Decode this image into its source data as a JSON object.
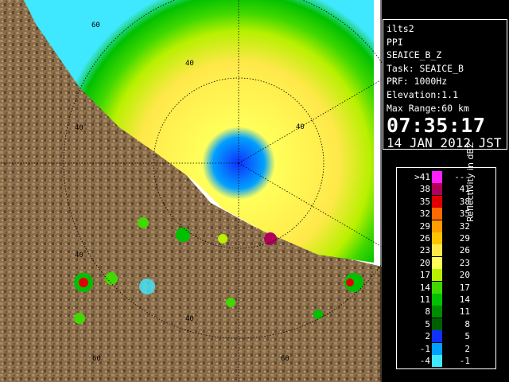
{
  "info": {
    "radar": "ilts2",
    "mode": "PPI",
    "product": "SEAICE_B_Z",
    "task": "Task: SEAICE_B",
    "prf": "PRF: 1000Hz",
    "elevation": "Elevation:1.1",
    "max_range": "Max Range:60 km",
    "time": "07:35:17",
    "date": "14 JAN 2012 JST"
  },
  "map": {
    "range_labels": [
      "60",
      "40",
      "40",
      "40",
      "40",
      "60",
      "40",
      "60"
    ]
  },
  "legend": {
    "title": "Reflectivity in dBZ",
    "rows": [
      {
        "lo": ">41",
        "hi": "---",
        "color": "#ff20ff"
      },
      {
        "lo": "38",
        "hi": "41",
        "color": "#b0005a"
      },
      {
        "lo": "35",
        "hi": "38",
        "color": "#e00000"
      },
      {
        "lo": "32",
        "hi": "35",
        "color": "#ff6a00"
      },
      {
        "lo": "29",
        "hi": "32",
        "color": "#ff9c00"
      },
      {
        "lo": "26",
        "hi": "29",
        "color": "#ffc400"
      },
      {
        "lo": "23",
        "hi": "26",
        "color": "#ffe84a"
      },
      {
        "lo": "20",
        "hi": "23",
        "color": "#ffff5a"
      },
      {
        "lo": "17",
        "hi": "20",
        "color": "#b8f000"
      },
      {
        "lo": "14",
        "hi": "17",
        "color": "#40d800"
      },
      {
        "lo": "11",
        "hi": "14",
        "color": "#00c000"
      },
      {
        "lo": "8",
        "hi": "11",
        "color": "#008c00"
      },
      {
        "lo": "5",
        "hi": "8",
        "color": "#006000"
      },
      {
        "lo": "2",
        "hi": "5",
        "color": "#1030ff"
      },
      {
        "lo": "-1",
        "hi": "2",
        "color": "#00a0ff"
      },
      {
        "lo": "-4",
        "hi": "-1",
        "color": "#40e8ff"
      }
    ]
  }
}
